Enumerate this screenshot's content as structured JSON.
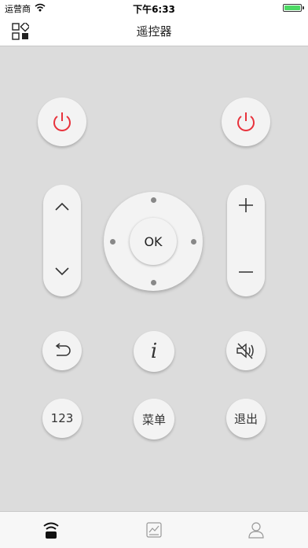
{
  "status_bar": {
    "carrier": "运营商",
    "time": "下午6:33"
  },
  "nav": {
    "title": "遥控器"
  },
  "remote": {
    "ok_label": "OK",
    "num_label": "123",
    "menu_label": "菜单",
    "exit_label": "退出"
  },
  "colors": {
    "power_red": "#e8323c",
    "battery_green": "#4cd964",
    "background": "#dcdcdc"
  },
  "icons": {
    "grid": "grid-icon",
    "power": "power-icon",
    "up": "chevron-up-icon",
    "down": "chevron-down-icon",
    "plus": "plus-icon",
    "minus": "minus-icon",
    "back": "back-icon",
    "info": "info-icon",
    "mute": "mute-icon",
    "remote_tab": "remote-tab-icon",
    "chart_tab": "chart-tab-icon",
    "user_tab": "user-tab-icon"
  }
}
